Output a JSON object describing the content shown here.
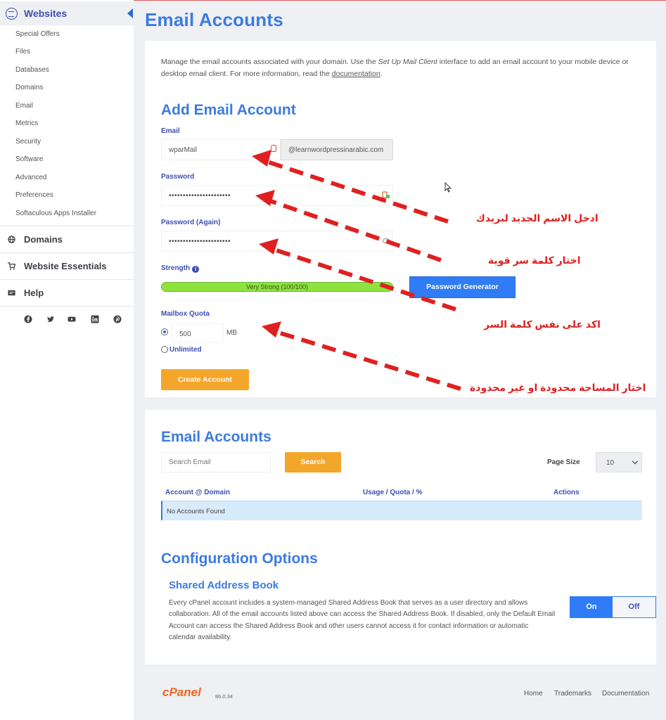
{
  "sidebar": {
    "header": "Websites",
    "items": [
      "Special Offers",
      "Files",
      "Databases",
      "Domains",
      "Email",
      "Metrics",
      "Security",
      "Software",
      "Advanced",
      "Preferences",
      "Softaculous Apps Installer"
    ],
    "sections": [
      "Domains",
      "Website Essentials",
      "Help"
    ],
    "social_icons": [
      "facebook-icon",
      "twitter-icon",
      "youtube-icon",
      "linkedin-icon",
      "pinterest-icon"
    ]
  },
  "page": {
    "title": "Email Accounts"
  },
  "intro": {
    "part1": "Manage the email accounts associated with your domain. Use the ",
    "client_link": "Set Up Mail Client",
    "part2": " interface to add an email account to your mobile device or desktop email client. For more information, read the ",
    "doc_link": "documentation",
    "part3": "."
  },
  "add_form": {
    "heading": "Add Email Account",
    "email_label": "Email",
    "email_value": "wparMail",
    "domain": "@learnwordpressinarabic.com",
    "password_label": "Password",
    "password_value": "••••••••••••••••••••••",
    "password_again_label": "Password (Again)",
    "password_again_value": "••••••••••••••••••••••",
    "strength_label": "Strength",
    "strength_text": "Very Strong (100/100)",
    "strength_percent": 100,
    "generator_button": "Password Generator",
    "quota_label": "Mailbox Quota",
    "quota_value": "500",
    "quota_unit": "MB",
    "unlimited_label": "Unlimited",
    "create_button": "Create Account"
  },
  "accounts": {
    "heading": "Email Accounts",
    "search_placeholder": "Search Email",
    "search_button": "Search",
    "page_size_label": "Page Size",
    "page_size_value": "10",
    "columns": [
      "Account @ Domain",
      "Usage / Quota / %",
      "Actions"
    ],
    "empty_text": "No Accounts Found"
  },
  "config": {
    "heading": "Configuration Options",
    "sub_heading": "Shared Address Book",
    "text": "Every cPanel account includes a system-managed Shared Address Book that serves as a user directory and allows collaboration. All of the email accounts listed above can access the Shared Address Book. If disabled, only the Default Email Account can access the Shared Address Book and other users cannot access it for contact information or automatic calendar availability.",
    "toggle_on": "On",
    "toggle_off": "Off"
  },
  "footer": {
    "logo": "cPanel",
    "version": "86.0.34",
    "links": [
      "Home",
      "Trademarks",
      "Documentation"
    ]
  },
  "annotations": [
    "ادخل الاسم الجديد لبريدك",
    "اختار كلمة سر قوية",
    "اكد على نفس كلمة السر",
    "اختار المساحة محدودة او غير محدودة"
  ],
  "colors": {
    "accent": "#3c7be0",
    "primary_button": "#2f7cf6",
    "orange_button": "#f4a62a",
    "annotation": "#e02020",
    "strength_fill": "#8de33c"
  }
}
